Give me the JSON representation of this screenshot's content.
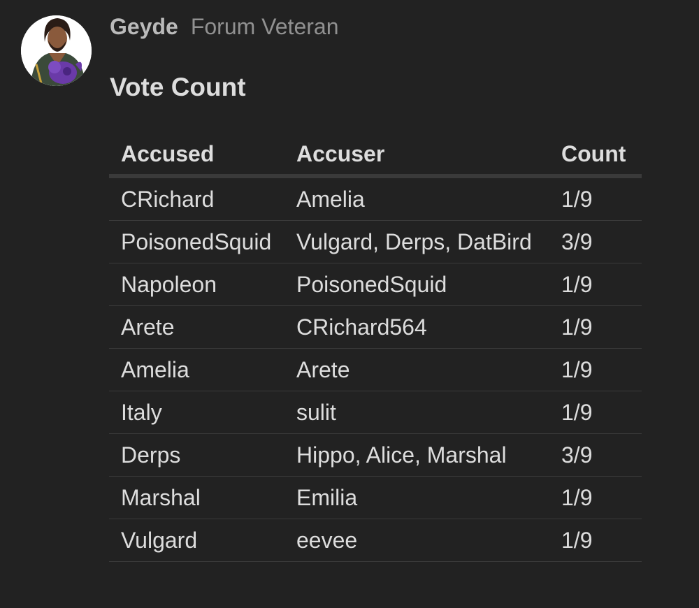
{
  "post": {
    "username": "Geyde",
    "user_title": "Forum Veteran",
    "heading": "Vote Count"
  },
  "table": {
    "headers": [
      "Accused",
      "Accuser",
      "Count"
    ],
    "rows": [
      [
        "CRichard",
        "Amelia",
        "1/9"
      ],
      [
        "PoisonedSquid",
        "Vulgard, Derps, DatBird",
        "3/9"
      ],
      [
        "Napoleon",
        "PoisonedSquid",
        "1/9"
      ],
      [
        "Arete",
        "CRichard564",
        "1/9"
      ],
      [
        "Amelia",
        "Arete",
        "1/9"
      ],
      [
        "Italy",
        "sulit",
        "1/9"
      ],
      [
        "Derps",
        "Hippo, Alice, Marshal",
        "3/9"
      ],
      [
        "Marshal",
        "Emilia",
        "1/9"
      ],
      [
        "Vulgard",
        "eevee",
        "1/9"
      ]
    ]
  },
  "colors": {
    "background": "#222222",
    "text": "#dddddd",
    "username": "#bbbbbb",
    "user_title": "#919191",
    "row_border": "#3a3a3a"
  }
}
